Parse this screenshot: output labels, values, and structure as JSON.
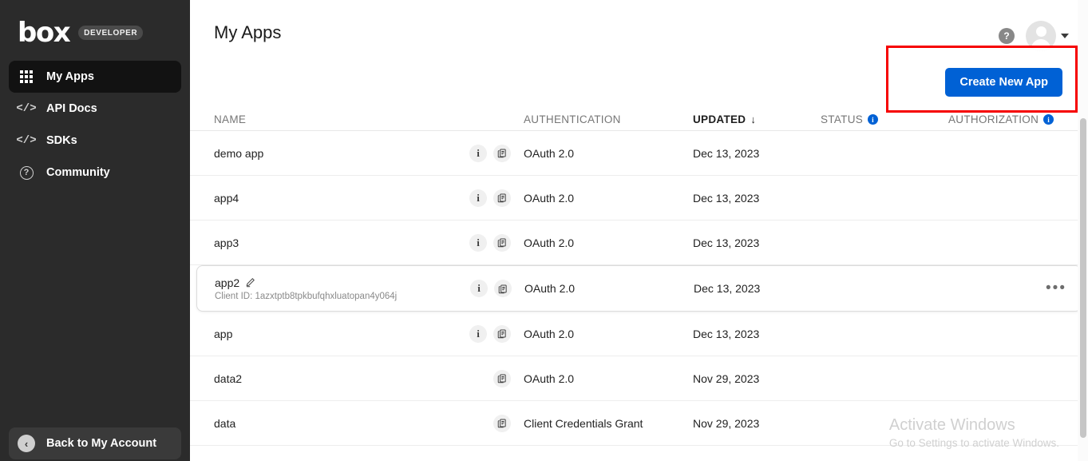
{
  "sidebar": {
    "brand": {
      "logo": "box",
      "tag": "DEVELOPER"
    },
    "items": [
      {
        "label": "My Apps",
        "icon": "grid-icon",
        "active": true
      },
      {
        "label": "API Docs",
        "icon": "code-icon",
        "active": false
      },
      {
        "label": "SDKs",
        "icon": "code-icon",
        "active": false
      },
      {
        "label": "Community",
        "icon": "question-icon",
        "active": false
      }
    ],
    "back": {
      "label": "Back to My Account",
      "icon": "back-arrow-icon"
    }
  },
  "header": {
    "title": "My Apps",
    "help_icon": "question-mark-icon",
    "avatar_icon": "user-avatar-icon",
    "caret_icon": "chevron-down-icon"
  },
  "toolbar": {
    "create_label": "Create New App",
    "highlight_color": "#f60000",
    "accent_color": "#0061d5"
  },
  "table": {
    "headers": {
      "name": "NAME",
      "authentication": "AUTHENTICATION",
      "updated": "UPDATED",
      "sort_arrow": "↓",
      "status": "STATUS",
      "authorization": "AUTHORIZATION",
      "info_glyph": "i"
    },
    "rows": [
      {
        "name": "demo app",
        "client_id": "",
        "has_info": true,
        "has_copy": true,
        "auth": "OAuth 2.0",
        "updated": "Dec 13, 2023",
        "status": "",
        "authorization": "",
        "selected": false,
        "has_menu": false
      },
      {
        "name": "app4",
        "client_id": "",
        "has_info": true,
        "has_copy": true,
        "auth": "OAuth 2.0",
        "updated": "Dec 13, 2023",
        "status": "",
        "authorization": "",
        "selected": false,
        "has_menu": false
      },
      {
        "name": "app3",
        "client_id": "",
        "has_info": true,
        "has_copy": true,
        "auth": "OAuth 2.0",
        "updated": "Dec 13, 2023",
        "status": "",
        "authorization": "",
        "selected": false,
        "has_menu": false
      },
      {
        "name": "app2",
        "client_id": "Client ID: 1azxtptb8tpkbufqhxluatopan4y064j",
        "has_info": true,
        "has_copy": true,
        "auth": "OAuth 2.0",
        "updated": "Dec 13, 2023",
        "status": "",
        "authorization": "",
        "selected": true,
        "has_menu": true,
        "menu_glyph": "•••",
        "edit_icon": "pencil-icon"
      },
      {
        "name": "app",
        "client_id": "",
        "has_info": true,
        "has_copy": true,
        "auth": "OAuth 2.0",
        "updated": "Dec 13, 2023",
        "status": "",
        "authorization": "",
        "selected": false,
        "has_menu": false
      },
      {
        "name": "data2",
        "client_id": "",
        "has_info": false,
        "has_copy": true,
        "auth": "OAuth 2.0",
        "updated": "Nov 29, 2023",
        "status": "",
        "authorization": "",
        "selected": false,
        "has_menu": false
      },
      {
        "name": "data",
        "client_id": "",
        "has_info": false,
        "has_copy": true,
        "auth": "Client Credentials Grant",
        "updated": "Nov 29, 2023",
        "status": "",
        "authorization": "",
        "selected": false,
        "has_menu": false
      }
    ]
  },
  "watermark": {
    "title": "Activate Windows",
    "subtitle": "Go to Settings to activate Windows."
  }
}
